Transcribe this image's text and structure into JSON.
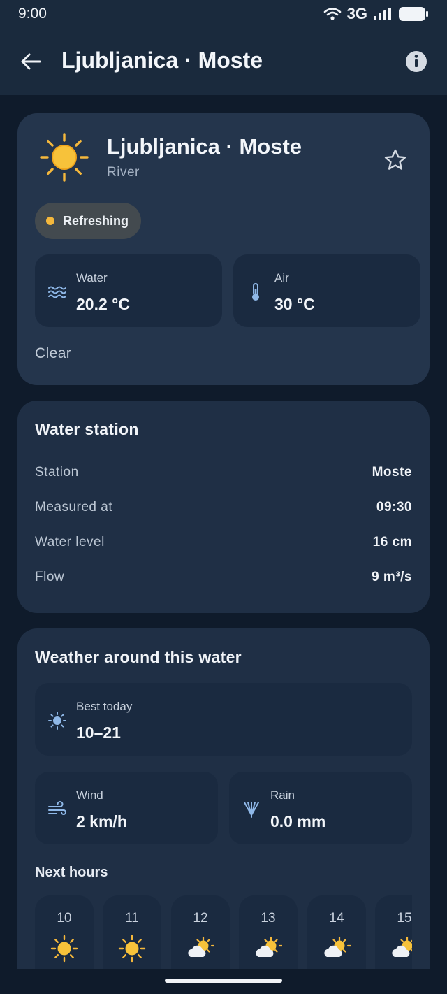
{
  "status_bar": {
    "time": "9:00",
    "network": "3G"
  },
  "app_bar": {
    "title": "Ljubljanica · Moste"
  },
  "hero": {
    "title": "Ljubljanica · Moste",
    "subtitle": "River",
    "status_pill": "Refreshing",
    "water": {
      "label": "Water",
      "value": "20.2 °C"
    },
    "air": {
      "label": "Air",
      "value": "30 °C"
    },
    "condition": "Clear"
  },
  "station": {
    "heading": "Water station",
    "rows": [
      {
        "key": "Station",
        "value": "Moste"
      },
      {
        "key": "Measured at",
        "value": "09:30"
      },
      {
        "key": "Water level",
        "value": "16 cm"
      },
      {
        "key": "Flow",
        "value": "9 m³/s"
      }
    ]
  },
  "weather": {
    "heading": "Weather around this water",
    "best": {
      "label": "Best today",
      "value": "10–21"
    },
    "wind": {
      "label": "Wind",
      "value": "2 km/h"
    },
    "rain": {
      "label": "Rain",
      "value": "0.0 mm"
    },
    "next_hours_label": "Next hours",
    "hours": [
      {
        "hour": "10",
        "icon": "sun-icon"
      },
      {
        "hour": "11",
        "icon": "sun-icon"
      },
      {
        "hour": "12",
        "icon": "partly-cloudy-icon"
      },
      {
        "hour": "13",
        "icon": "partly-cloudy-icon"
      },
      {
        "hour": "14",
        "icon": "partly-cloudy-icon"
      },
      {
        "hour": "15",
        "icon": "partly-cloudy-icon"
      }
    ]
  },
  "colors": {
    "accent_sun": "#f5b83c",
    "background": "#0f1b2b",
    "card": "#1f2f45",
    "icon_blue": "#8fb8e8"
  }
}
